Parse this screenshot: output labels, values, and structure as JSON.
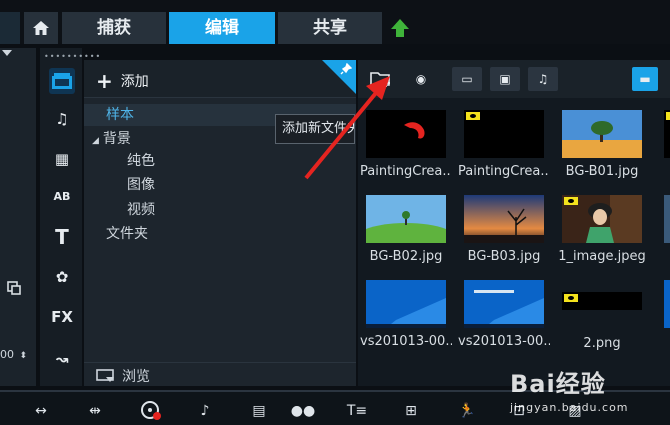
{
  "tabs": {
    "capture": "捕获",
    "edit": "编辑",
    "share": "共享"
  },
  "library": {
    "add_label": "添加",
    "tree": [
      {
        "label": "样本",
        "selected": true
      },
      {
        "label": "背景",
        "expanded": true
      },
      {
        "label": "纯色"
      },
      {
        "label": "图像"
      },
      {
        "label": "视频"
      },
      {
        "label": "文件夹"
      }
    ],
    "browse_label": "浏览"
  },
  "tooltip": {
    "text": "添加新文件夹"
  },
  "left_panel": {
    "stepper_value": "00"
  },
  "strip": {
    "title_label": "T",
    "text_label": "AB",
    "fx_label": "FX"
  },
  "media": {
    "items": [
      {
        "label": "PaintingCrea...",
        "thumb": "black"
      },
      {
        "label": "PaintingCrea...",
        "thumb": "black-tag"
      },
      {
        "label": "BG-B01.jpg",
        "thumb": "tree-sky"
      },
      {
        "label": "BG-B02.jpg",
        "thumb": "green-hill"
      },
      {
        "label": "BG-B03.jpg",
        "thumb": "sunset-tree"
      },
      {
        "label": "1_image.jpeg",
        "thumb": "portrait"
      },
      {
        "label": "vs201013-00...",
        "thumb": "desktop-blue"
      },
      {
        "label": "vs201013-00...",
        "thumb": "desktop-blue-2"
      },
      {
        "label": "2.png",
        "thumb": "black-tag-small"
      }
    ]
  },
  "watermark": {
    "brand": "Bai经验",
    "url": "jingyan.baidu.com"
  },
  "colors": {
    "accent": "#1aa3e8",
    "annotation_red": "#e52420",
    "tag_yellow": "#f4e21d"
  }
}
